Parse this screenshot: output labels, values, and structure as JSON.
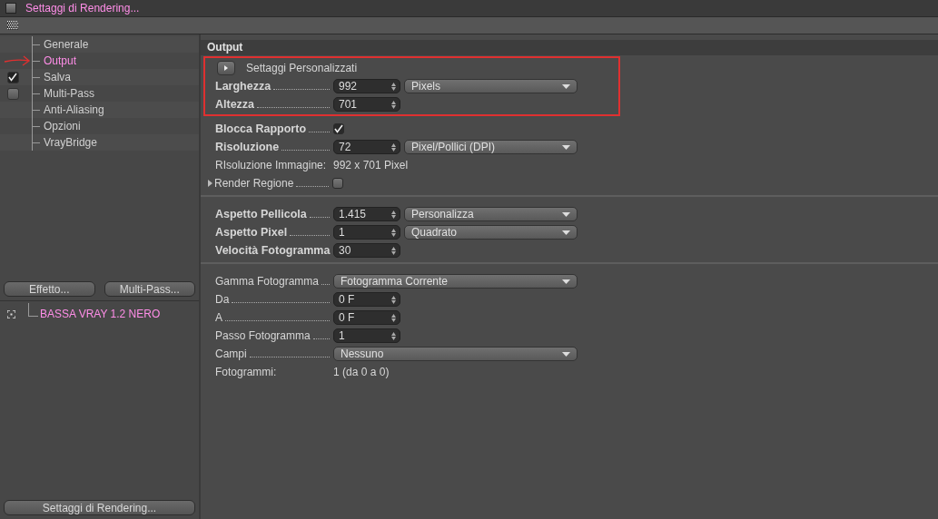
{
  "window": {
    "title": "Settaggi di Rendering..."
  },
  "sidebar": {
    "items": [
      {
        "label": "Generale",
        "kind": "plain",
        "selected": false,
        "annotated": false
      },
      {
        "label": "Output",
        "kind": "plain",
        "selected": true,
        "annotated": true
      },
      {
        "label": "Salva",
        "kind": "checkbox",
        "checked": true,
        "selected": false,
        "annotated": false
      },
      {
        "label": "Multi-Pass",
        "kind": "checkbox",
        "checked": false,
        "selected": false,
        "annotated": false
      },
      {
        "label": "Anti-Aliasing",
        "kind": "plain",
        "selected": false,
        "annotated": false
      },
      {
        "label": "Opzioni",
        "kind": "plain",
        "selected": false,
        "annotated": false
      },
      {
        "label": "VrayBridge",
        "kind": "plain",
        "selected": false,
        "annotated": false
      }
    ],
    "buttons": [
      "Effetto...",
      "Multi-Pass..."
    ],
    "presets": [
      {
        "label": "BASSA VRAY 1.2 NERO",
        "selected": true
      }
    ],
    "bottom_button": "Settaggi di Rendering..."
  },
  "panel": {
    "title": "Output",
    "groups": [
      {
        "highlighted": true,
        "divider_after": false,
        "rows": [
          {
            "kind": "toggle",
            "label": "Settaggi  Personalizzati"
          },
          {
            "kind": "number_dropdown",
            "label": "Larghezza",
            "bold": true,
            "value": "992",
            "option": "Pixels"
          },
          {
            "kind": "number",
            "label": "Altezza",
            "bold": true,
            "value": "701"
          }
        ]
      },
      {
        "highlighted": false,
        "divider_after": true,
        "rows": [
          {
            "kind": "check",
            "label": "Blocca Rapporto",
            "bold": true,
            "checked": true
          },
          {
            "kind": "number_dropdown",
            "label": "Risoluzione",
            "bold": true,
            "value": "72",
            "option": "Pixel/Pollici (DPI)"
          },
          {
            "kind": "info",
            "label": "RIsoluzione Immagine:",
            "value": "992 x 701 Pixel"
          },
          {
            "kind": "check",
            "label": "Render Regione",
            "bold": false,
            "checked": false,
            "expanded": false
          }
        ]
      },
      {
        "highlighted": false,
        "divider_after": true,
        "rows": [
          {
            "kind": "number_dropdown",
            "label": "Aspetto Pellicola",
            "bold": true,
            "value": "1.415",
            "option": "Personalizza"
          },
          {
            "kind": "number_dropdown",
            "label": "Aspetto Pixel",
            "bold": true,
            "value": "1",
            "option": "Quadrato"
          },
          {
            "kind": "number",
            "label": "Velocità Fotogramma",
            "bold": true,
            "value": "30"
          }
        ]
      },
      {
        "highlighted": false,
        "divider_after": false,
        "rows": [
          {
            "kind": "dropdown",
            "label": "Gamma Fotogramma",
            "bold": false,
            "option": "Fotogramma Corrente"
          },
          {
            "kind": "number",
            "label": "Da",
            "bold": false,
            "value": "0 F"
          },
          {
            "kind": "number",
            "label": "A",
            "bold": false,
            "value": "0 F"
          },
          {
            "kind": "number",
            "label": "Passo Fotogramma",
            "bold": false,
            "value": "1"
          },
          {
            "kind": "dropdown",
            "label": "Campi",
            "bold": false,
            "option": "Nessuno"
          },
          {
            "kind": "info",
            "label": "Fotogrammi:",
            "value": "1 (da 0 a 0)"
          }
        ]
      }
    ]
  }
}
